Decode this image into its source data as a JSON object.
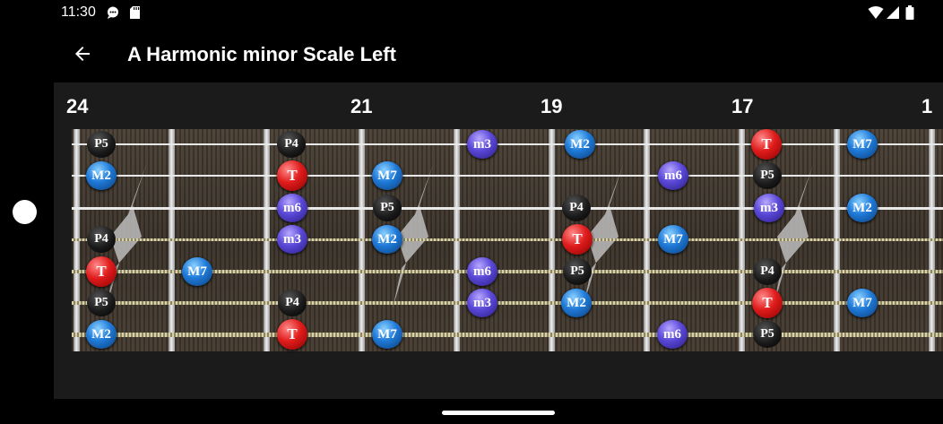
{
  "status_bar": {
    "time": "11:30",
    "icons": [
      "message-icon",
      "sd-card-icon",
      "wifi-icon",
      "cell-signal-icon",
      "battery-icon"
    ]
  },
  "app_bar": {
    "back_icon": "arrow-back-icon",
    "title": "A Harmonic minor Scale Left"
  },
  "fretboard": {
    "fret_numbers": [
      "24",
      "21",
      "19",
      "17",
      "1"
    ],
    "colors": {
      "tonic": "#e01c1c",
      "blue": "#1f7ad8",
      "purple": "#5a48d8",
      "black": "#1a1a1a"
    },
    "strings": [
      [
        {
          "label": "P5",
          "style": "black"
        },
        {
          "label": "P4",
          "style": "black"
        },
        {
          "label": "m3",
          "style": "purple"
        },
        {
          "label": "M2",
          "style": "blue"
        },
        {
          "label": "T",
          "style": "tonic"
        },
        {
          "label": "M7",
          "style": "blue"
        }
      ],
      [
        {
          "label": "M2",
          "style": "blue"
        },
        {
          "label": "T",
          "style": "tonic"
        },
        {
          "label": "M7",
          "style": "blue"
        },
        {
          "label": "m6",
          "style": "purple"
        },
        {
          "label": "P5",
          "style": "black"
        }
      ],
      [
        {
          "label": "m6",
          "style": "purple"
        },
        {
          "label": "P5",
          "style": "black"
        },
        {
          "label": "P4",
          "style": "black"
        },
        {
          "label": "m3",
          "style": "purple"
        },
        {
          "label": "M2",
          "style": "blue"
        }
      ],
      [
        {
          "label": "P4",
          "style": "black"
        },
        {
          "label": "m3",
          "style": "purple"
        },
        {
          "label": "M2",
          "style": "blue"
        },
        {
          "label": "T",
          "style": "tonic"
        },
        {
          "label": "M7",
          "style": "blue"
        }
      ],
      [
        {
          "label": "T",
          "style": "tonic"
        },
        {
          "label": "M7",
          "style": "blue"
        },
        {
          "label": "m6",
          "style": "purple"
        },
        {
          "label": "P5",
          "style": "black"
        },
        {
          "label": "P4",
          "style": "black"
        }
      ],
      [
        {
          "label": "P5",
          "style": "black"
        },
        {
          "label": "P4",
          "style": "black"
        },
        {
          "label": "m3",
          "style": "purple"
        },
        {
          "label": "M2",
          "style": "blue"
        },
        {
          "label": "T",
          "style": "tonic"
        },
        {
          "label": "M7",
          "style": "blue"
        }
      ],
      [
        {
          "label": "M2",
          "style": "blue"
        },
        {
          "label": "T",
          "style": "tonic"
        },
        {
          "label": "M7",
          "style": "blue"
        },
        {
          "label": "m6",
          "style": "purple"
        },
        {
          "label": "P5",
          "style": "black"
        }
      ]
    ]
  }
}
